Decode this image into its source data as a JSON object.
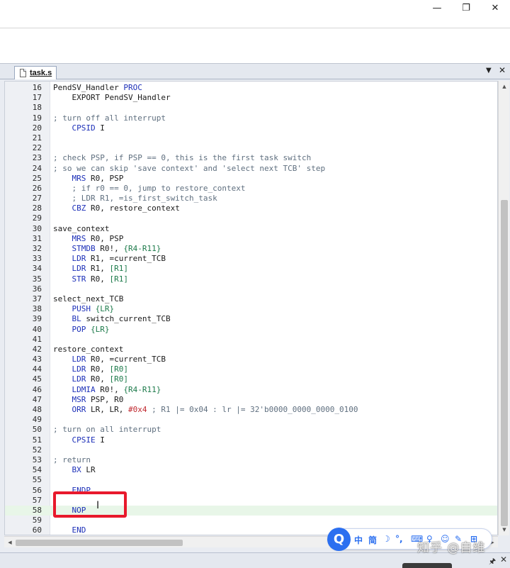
{
  "window": {
    "minimize_glyph": "—",
    "maximize_glyph": "❐",
    "close_glyph": "✕"
  },
  "editor": {
    "tab": {
      "label": "task.s"
    },
    "tab_dropdown_glyph": "▼",
    "tab_close_glyph": "✕",
    "current_line": 58,
    "lines": [
      {
        "n": "16",
        "t": [
          {
            "c": "txt",
            "s": "PendSV_Handler "
          },
          {
            "c": "kw",
            "s": "PROC"
          }
        ]
      },
      {
        "n": "17",
        "t": [
          {
            "c": "txt",
            "s": "    EXPORT PendSV_Handler"
          }
        ]
      },
      {
        "n": "18",
        "t": []
      },
      {
        "n": "19",
        "t": [
          {
            "c": "cm",
            "s": "; turn off all interrupt"
          }
        ]
      },
      {
        "n": "20",
        "t": [
          {
            "c": "kw",
            "s": "    CPSID"
          },
          {
            "c": "txt",
            "s": " I"
          }
        ]
      },
      {
        "n": "21",
        "t": []
      },
      {
        "n": "22",
        "t": []
      },
      {
        "n": "23",
        "t": [
          {
            "c": "cm",
            "s": "; check PSP, if PSP == 0, this is the first task switch"
          }
        ]
      },
      {
        "n": "24",
        "t": [
          {
            "c": "cm",
            "s": "; so we can skip 'save context' and 'select next TCB' step"
          }
        ]
      },
      {
        "n": "25",
        "t": [
          {
            "c": "kw",
            "s": "    MRS"
          },
          {
            "c": "txt",
            "s": " R0, PSP"
          }
        ]
      },
      {
        "n": "26",
        "t": [
          {
            "c": "cm",
            "s": "    ; if r0 == 0, jump to restore_context"
          }
        ]
      },
      {
        "n": "27",
        "t": [
          {
            "c": "cm",
            "s": "    ; LDR R1, =is_first_switch_task"
          }
        ]
      },
      {
        "n": "28",
        "t": [
          {
            "c": "kw",
            "s": "    CBZ"
          },
          {
            "c": "txt",
            "s": " R0, restore_context"
          }
        ]
      },
      {
        "n": "29",
        "t": []
      },
      {
        "n": "30",
        "t": [
          {
            "c": "txt",
            "s": "save_context"
          }
        ]
      },
      {
        "n": "31",
        "t": [
          {
            "c": "kw",
            "s": "    MRS"
          },
          {
            "c": "txt",
            "s": " R0, PSP"
          }
        ]
      },
      {
        "n": "32",
        "t": [
          {
            "c": "kw",
            "s": "    STMDB"
          },
          {
            "c": "txt",
            "s": " R0!, "
          },
          {
            "c": "reg",
            "s": "{R4-R11}"
          }
        ]
      },
      {
        "n": "33",
        "t": [
          {
            "c": "kw",
            "s": "    LDR"
          },
          {
            "c": "txt",
            "s": " R1, =current_TCB"
          }
        ]
      },
      {
        "n": "34",
        "t": [
          {
            "c": "kw",
            "s": "    LDR"
          },
          {
            "c": "txt",
            "s": " R1, "
          },
          {
            "c": "reg",
            "s": "[R1]"
          }
        ]
      },
      {
        "n": "35",
        "t": [
          {
            "c": "kw",
            "s": "    STR"
          },
          {
            "c": "txt",
            "s": " R0, "
          },
          {
            "c": "reg",
            "s": "[R1]"
          }
        ]
      },
      {
        "n": "36",
        "t": []
      },
      {
        "n": "37",
        "t": [
          {
            "c": "txt",
            "s": "select_next_TCB"
          }
        ]
      },
      {
        "n": "38",
        "t": [
          {
            "c": "kw",
            "s": "    PUSH"
          },
          {
            "c": "txt",
            "s": " "
          },
          {
            "c": "reg",
            "s": "{LR}"
          }
        ]
      },
      {
        "n": "39",
        "t": [
          {
            "c": "kw",
            "s": "    BL"
          },
          {
            "c": "txt",
            "s": " switch_current_TCB"
          }
        ]
      },
      {
        "n": "40",
        "t": [
          {
            "c": "kw",
            "s": "    POP"
          },
          {
            "c": "txt",
            "s": " "
          },
          {
            "c": "reg",
            "s": "{LR}"
          }
        ]
      },
      {
        "n": "41",
        "t": []
      },
      {
        "n": "42",
        "t": [
          {
            "c": "txt",
            "s": "restore_context"
          }
        ]
      },
      {
        "n": "43",
        "t": [
          {
            "c": "kw",
            "s": "    LDR"
          },
          {
            "c": "txt",
            "s": " R0, =current_TCB"
          }
        ]
      },
      {
        "n": "44",
        "t": [
          {
            "c": "kw",
            "s": "    LDR"
          },
          {
            "c": "txt",
            "s": " R0, "
          },
          {
            "c": "reg",
            "s": "[R0]"
          }
        ]
      },
      {
        "n": "45",
        "t": [
          {
            "c": "kw",
            "s": "    LDR"
          },
          {
            "c": "txt",
            "s": " R0, "
          },
          {
            "c": "reg",
            "s": "[R0]"
          }
        ]
      },
      {
        "n": "46",
        "t": [
          {
            "c": "kw",
            "s": "    LDMIA"
          },
          {
            "c": "txt",
            "s": " R0!, "
          },
          {
            "c": "reg",
            "s": "{R4-R11}"
          }
        ]
      },
      {
        "n": "47",
        "t": [
          {
            "c": "kw",
            "s": "    MSR"
          },
          {
            "c": "txt",
            "s": " PSP, R0"
          }
        ]
      },
      {
        "n": "48",
        "t": [
          {
            "c": "kw",
            "s": "    ORR"
          },
          {
            "c": "txt",
            "s": " LR, LR, "
          },
          {
            "c": "num",
            "s": "#0x4"
          },
          {
            "c": "cm",
            "s": " ; R1 |= 0x04 : lr |= 32'b0000_0000_0000_0100"
          }
        ]
      },
      {
        "n": "49",
        "t": []
      },
      {
        "n": "50",
        "t": [
          {
            "c": "cm",
            "s": "; turn on all interrupt"
          }
        ]
      },
      {
        "n": "51",
        "t": [
          {
            "c": "kw",
            "s": "    CPSIE"
          },
          {
            "c": "txt",
            "s": " I"
          }
        ]
      },
      {
        "n": "52",
        "t": []
      },
      {
        "n": "53",
        "t": [
          {
            "c": "cm",
            "s": "; return"
          }
        ]
      },
      {
        "n": "54",
        "t": [
          {
            "c": "kw",
            "s": "    BX"
          },
          {
            "c": "txt",
            "s": " LR"
          }
        ]
      },
      {
        "n": "55",
        "t": []
      },
      {
        "n": "56",
        "t": [
          {
            "c": "kw",
            "s": "    ENDP"
          }
        ]
      },
      {
        "n": "57",
        "t": []
      },
      {
        "n": "58",
        "t": [
          {
            "c": "kw",
            "s": "    NOP"
          }
        ]
      },
      {
        "n": "59",
        "t": []
      },
      {
        "n": "60",
        "t": [
          {
            "c": "kw",
            "s": "    END"
          }
        ]
      }
    ]
  },
  "scrollbar": {
    "up_glyph": "▲",
    "down_glyph": "▼",
    "left_glyph": "◀",
    "right_glyph": "▶"
  },
  "statusbar": {
    "pin_glyph": "🖈",
    "close_glyph": "✕"
  },
  "ime": {
    "logo": "Q",
    "items": [
      "中",
      "简",
      "☽",
      "°,",
      "⌨",
      "♀",
      "☺",
      "✎",
      "⊞"
    ]
  },
  "watermark": {
    "text": "知乎 @自维"
  },
  "colors": {
    "highlight": "#e8192c",
    "keyword": "#1c2fb8",
    "comment": "#5f6f7f",
    "register": "#1c7a4a",
    "immediate": "#c0282f"
  }
}
